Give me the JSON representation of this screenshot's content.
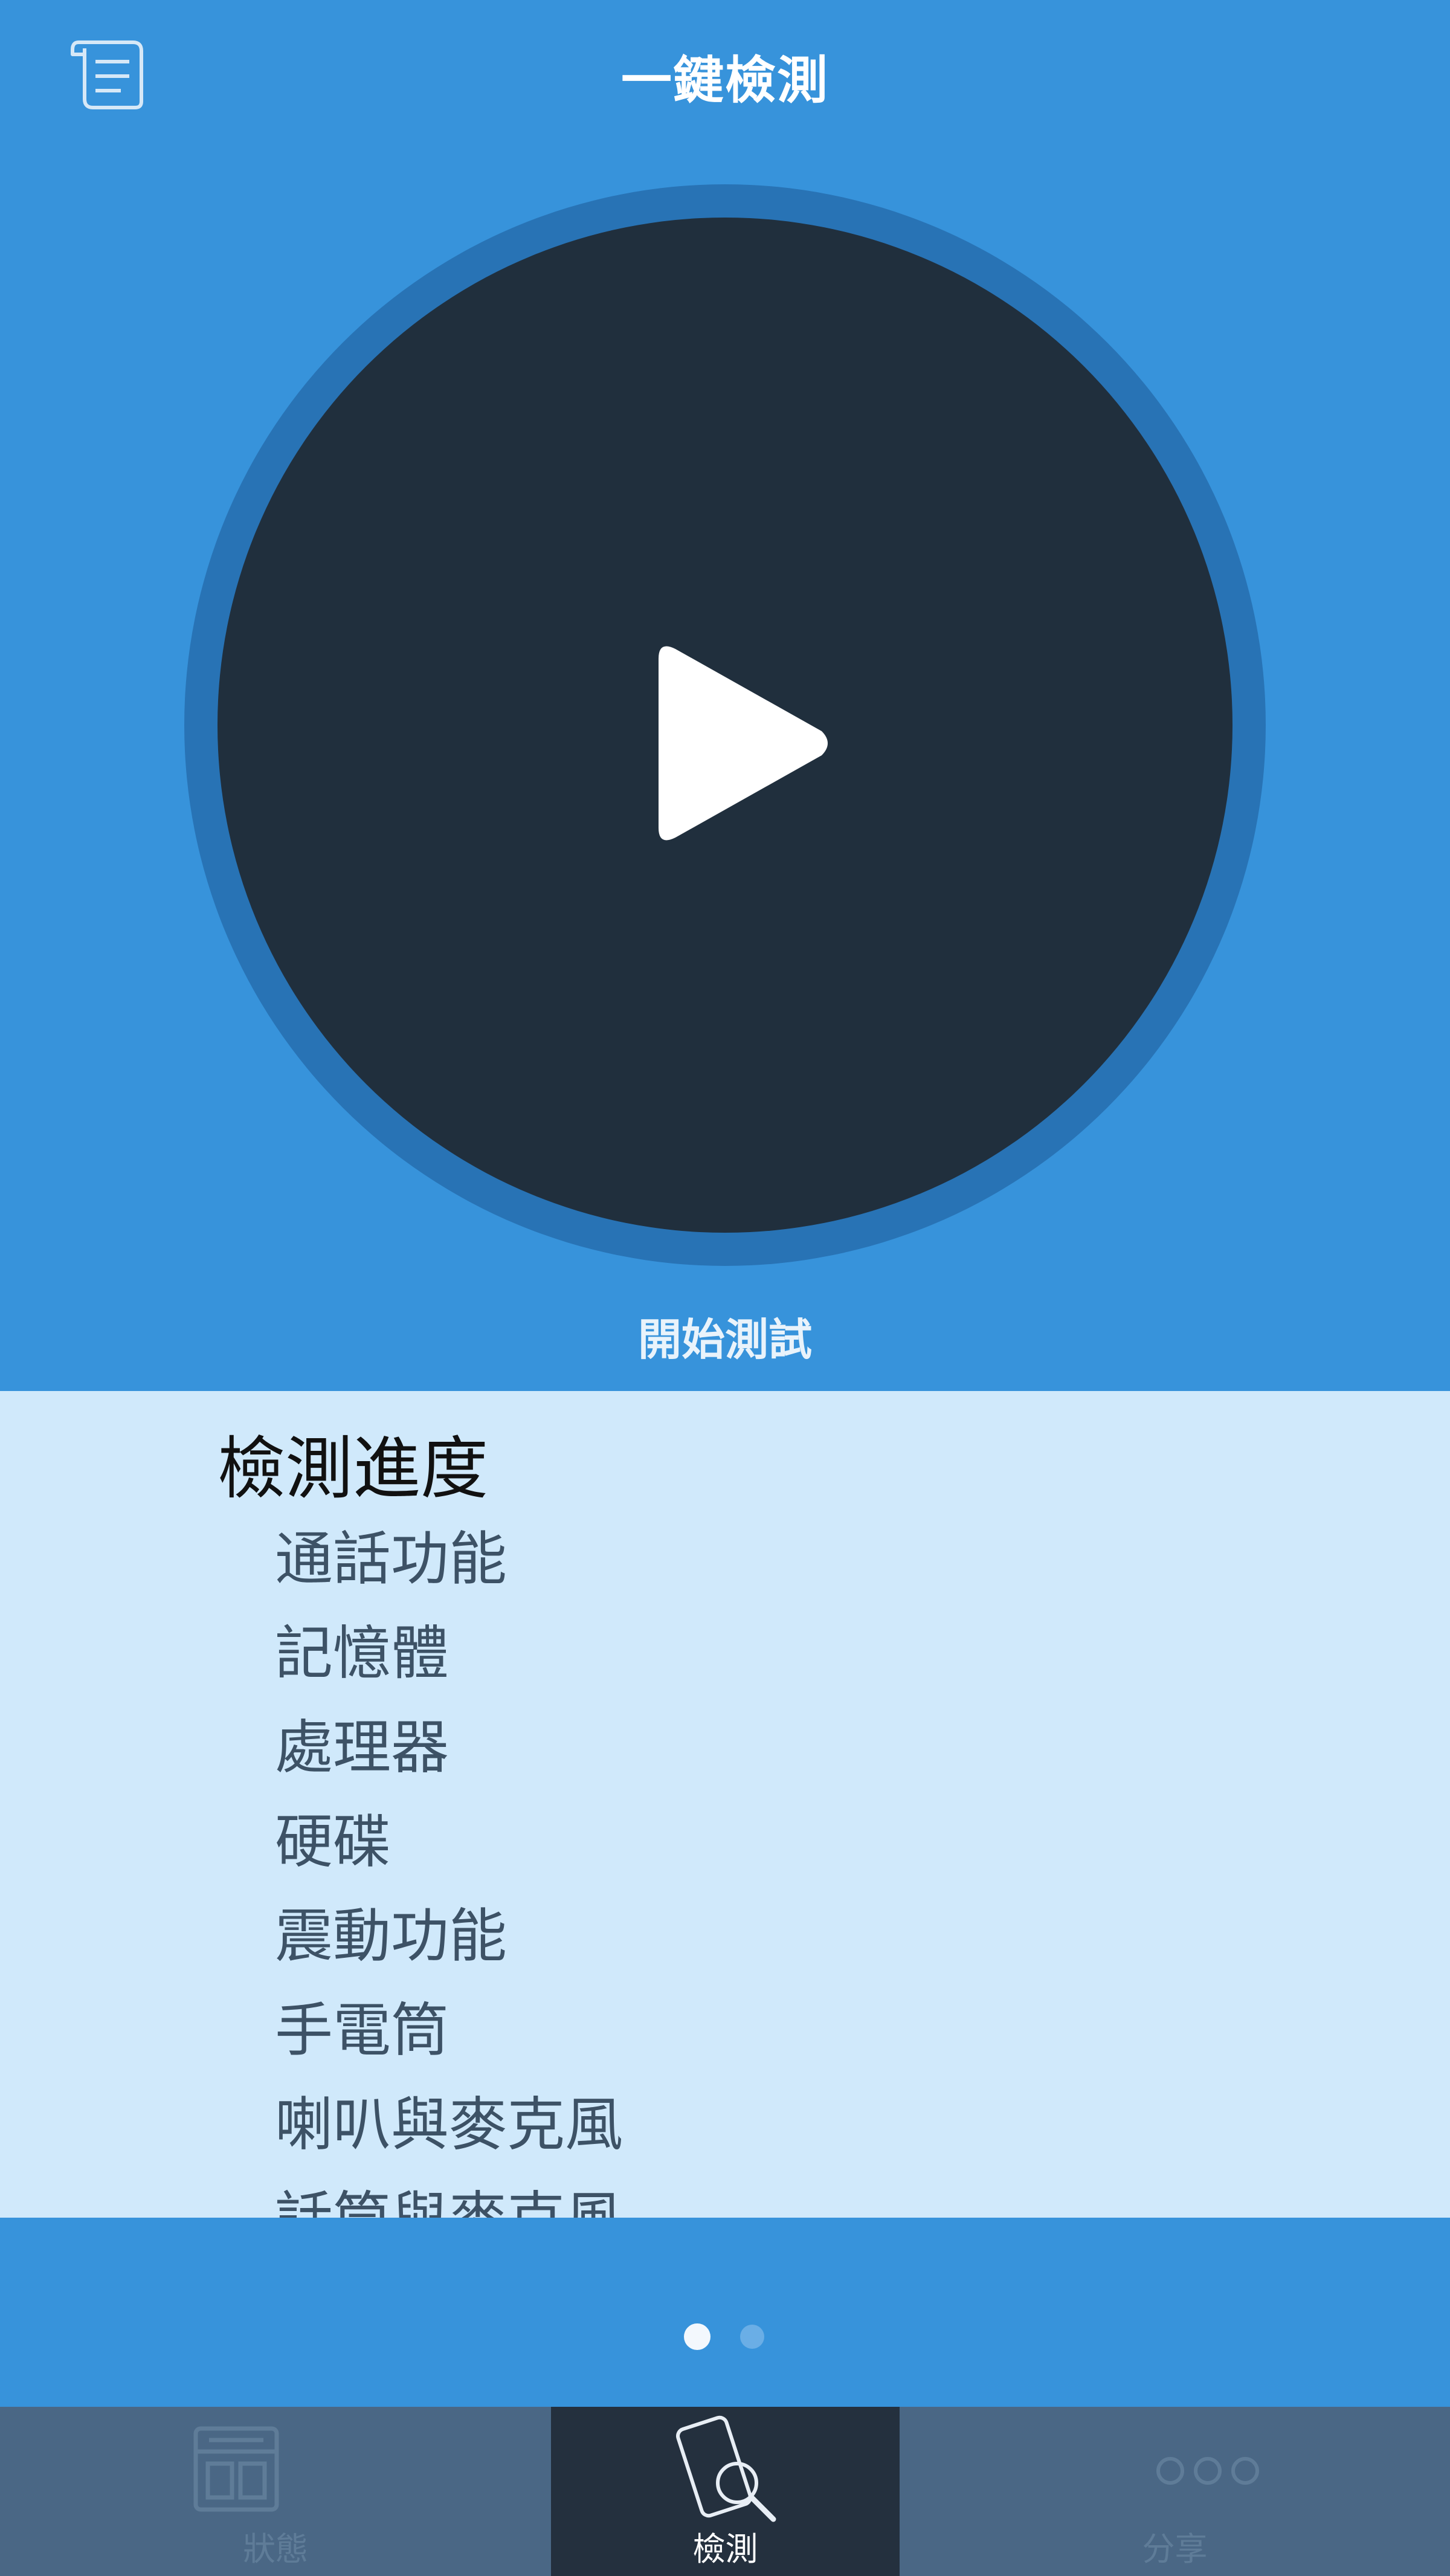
{
  "header": {
    "title": "一鍵檢測",
    "report_icon": "report-icon"
  },
  "start": {
    "icon": "play-icon",
    "label": "開始測試"
  },
  "progress": {
    "title": "檢測進度",
    "items": [
      "通話功能",
      "記憶體",
      "處理器",
      "硬碟",
      "震動功能",
      "手電筒",
      "喇叭與麥克風",
      "話筒與麥克風"
    ]
  },
  "pager": {
    "pages": 2,
    "active_index": 0
  },
  "tabs": [
    {
      "label": "狀態",
      "icon": "status-icon",
      "selected": false
    },
    {
      "label": "檢測",
      "icon": "phone-search-icon",
      "selected": true
    },
    {
      "label": "分享",
      "icon": "share-dots-icon",
      "selected": false
    }
  ],
  "colors": {
    "primary_blue": "#3793db",
    "ring_blue": "#2873b5",
    "button_dark": "#202f3d",
    "panel_light": "#d0e9fb",
    "tabbar": "#4a6785",
    "tab_selected": "#24303e"
  }
}
